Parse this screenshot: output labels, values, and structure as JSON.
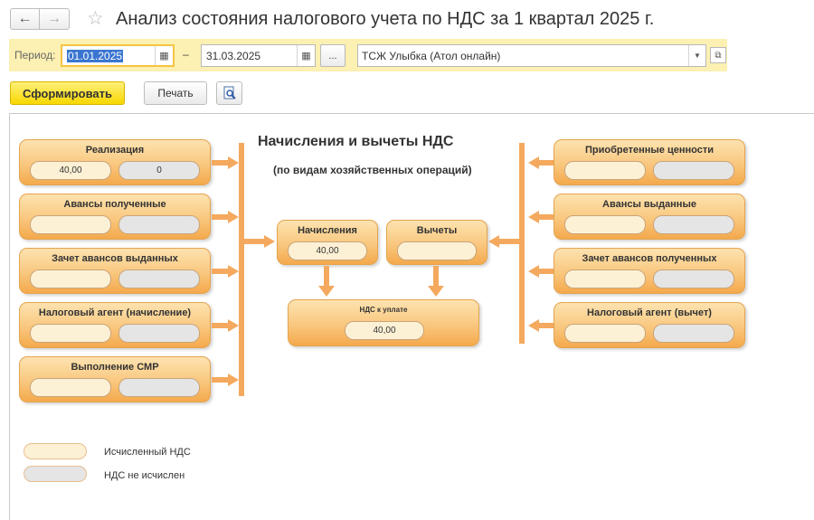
{
  "header": {
    "title": "Анализ состояния налогового учета по НДС за 1 квартал 2025 г.",
    "back_icon": "arrow-left-icon",
    "forward_icon": "arrow-right-icon",
    "favorite_icon": "star-icon"
  },
  "period": {
    "label": "Период:",
    "date_from": "01.01.2025",
    "date_to": "31.03.2025",
    "separator": "–",
    "choose_label": "...",
    "organization": "ТСЖ Улыбка (Атол онлайн)"
  },
  "toolbar": {
    "generate_label": "Сформировать",
    "print_label": "Печать"
  },
  "diagram": {
    "title": "Начисления и вычеты НДС",
    "subtitle": "(по видам хозяйственных операций)",
    "left_ops": [
      {
        "title": "Реализация",
        "v1": "40,00",
        "v2": "0"
      },
      {
        "title": "Авансы полученные",
        "v1": "",
        "v2": ""
      },
      {
        "title": "Зачет авансов выданных",
        "v1": "",
        "v2": ""
      },
      {
        "title": "Налоговый агент (начисление)",
        "v1": "",
        "v2": ""
      },
      {
        "title": "Выполнение СМР",
        "v1": "",
        "v2": ""
      }
    ],
    "right_ops": [
      {
        "title": "Приобретенные ценности",
        "v1": "",
        "v2": ""
      },
      {
        "title": "Авансы выданные",
        "v1": "",
        "v2": ""
      },
      {
        "title": "Зачет авансов полученных",
        "v1": "",
        "v2": ""
      },
      {
        "title": "Налоговый агент (вычет)",
        "v1": "",
        "v2": ""
      }
    ],
    "accruals": {
      "title": "Начисления",
      "value": "40,00"
    },
    "deductions": {
      "title": "Вычеты",
      "value": ""
    },
    "payable": {
      "title": "НДС к уплате",
      "value": "40,00"
    }
  },
  "legend": {
    "calculated": "Исчисленный НДС",
    "not_calculated": "НДС не исчислен"
  },
  "colors": {
    "accent_yellow": "#f8d800",
    "period_bg": "#fcf0b2",
    "box_orange": "#f9c77e",
    "arrow_orange": "#f4a95e"
  }
}
